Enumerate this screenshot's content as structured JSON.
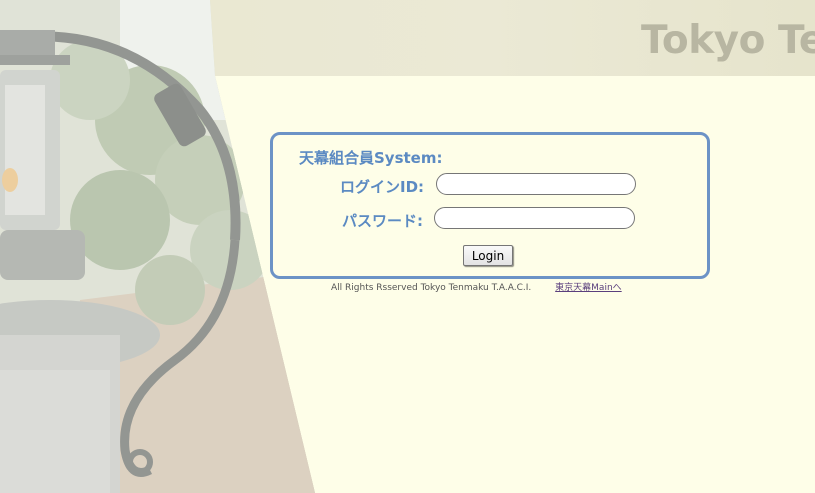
{
  "header": {
    "site_title": "Tokyo Ten"
  },
  "login": {
    "system_title": "天幕組合員System:",
    "id_label": "ログインID:",
    "id_value": "",
    "password_label": "パスワード:",
    "password_value": "",
    "login_button": "Login"
  },
  "footer": {
    "copyright": "All Rights Rsserved Tokyo Tenmaku T.A.A.C.I.",
    "main_link": "東京天幕Mainへ"
  },
  "colors": {
    "page_background": "#fefee8",
    "accent_blue": "#5b8ac2",
    "box_border": "#6c93c6",
    "title_gray": "#b8b6a2",
    "link_purple": "#5a3f7d"
  },
  "icons": {
    "photo": "lantern-photo"
  }
}
